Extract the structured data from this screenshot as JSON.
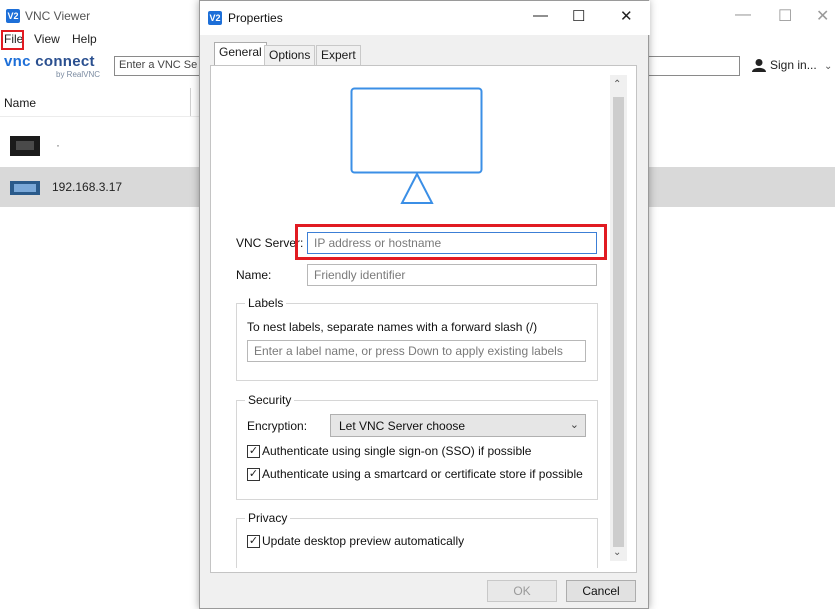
{
  "main_window": {
    "title": "VNC Viewer",
    "logo_text": "V2",
    "menus": [
      "File",
      "View",
      "Help"
    ],
    "brand_big_a": "vnc ",
    "brand_big_b": "connect",
    "brand_small": "by RealVNC",
    "address_text": "Enter a VNC Se",
    "sign_in": "Sign in...",
    "list_header": "Name",
    "rows": [
      {
        "label": "·"
      },
      {
        "label": "192.168.3.17"
      }
    ],
    "controls": {
      "minimize": "—",
      "maximize": "☐",
      "close": "✕"
    }
  },
  "dialog": {
    "title": "Properties",
    "logo_text": "V2",
    "controls": {
      "minimize": "—",
      "maximize": "☐",
      "close": "✕"
    },
    "tabs": [
      "General",
      "Options",
      "Expert"
    ],
    "vnc_server_label": "VNC Server:",
    "vnc_server_placeholder": "IP address or hostname",
    "name_label": "Name:",
    "name_placeholder": "Friendly identifier",
    "labels_group": "Labels",
    "labels_hint": "To nest labels, separate names with a forward slash (/)",
    "labels_placeholder": "Enter a label name, or press Down to apply existing labels",
    "security_group": "Security",
    "encryption_label": "Encryption:",
    "encryption_value": "Let VNC Server choose",
    "sso_label": "Authenticate using single sign-on (SSO) if possible",
    "sso_checked": true,
    "smartcard_label": "Authenticate using a smartcard or certificate store if possible",
    "smartcard_checked": true,
    "privacy_group": "Privacy",
    "preview_label": "Update desktop preview automatically",
    "preview_checked": true,
    "ok_label": "OK",
    "cancel_label": "Cancel"
  },
  "colors": {
    "accent": "#1d6fd8",
    "highlight_box": "#e11b22",
    "monitor_stroke": "#3b8fe6"
  }
}
